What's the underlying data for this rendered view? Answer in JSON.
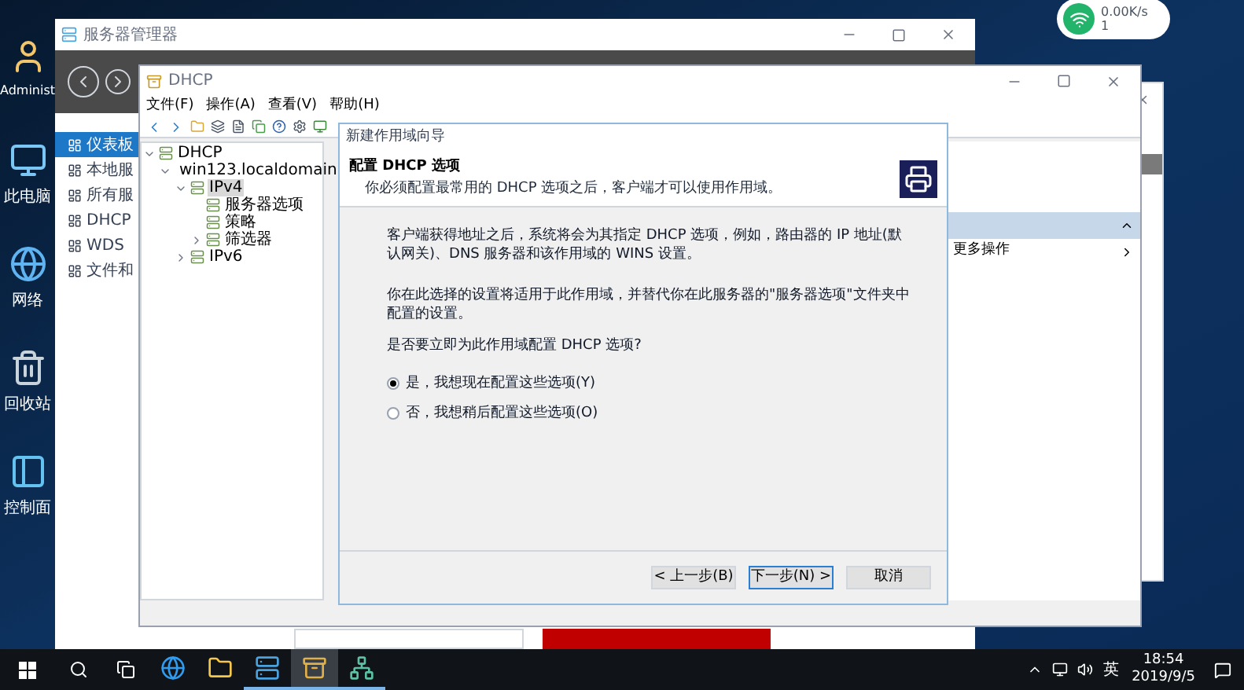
{
  "desktop_icons": [
    {
      "label": "Administ"
    },
    {
      "label": "此电脑"
    },
    {
      "label": "网络"
    },
    {
      "label": "回收站"
    },
    {
      "label": "控制面"
    }
  ],
  "net_widget": {
    "speed": "0.00K/s",
    "count": "1"
  },
  "server_manager": {
    "title": "服务器管理器",
    "nav": [
      {
        "label": "仪表板",
        "selected": true
      },
      {
        "label": "本地服",
        "selected": false
      },
      {
        "label": "所有服",
        "selected": false
      },
      {
        "label": "DHCP",
        "selected": false
      },
      {
        "label": "WDS",
        "selected": false
      },
      {
        "label": "文件和",
        "selected": false
      }
    ]
  },
  "dhcp_window": {
    "title": "DHCP",
    "menu": [
      "文件(F)",
      "操作(A)",
      "查看(V)",
      "帮助(H)"
    ],
    "tree": [
      {
        "label": "DHCP",
        "expanded": true,
        "selected": false,
        "children": [
          {
            "label": "win123.localdomain",
            "expanded": true,
            "selected": false,
            "children": [
              {
                "label": "IPv4",
                "expanded": true,
                "selected": true,
                "children": [
                  {
                    "label": "服务器选项",
                    "selected": false
                  },
                  {
                    "label": "策略",
                    "selected": false
                  },
                  {
                    "label": "筛选器",
                    "expanded": false,
                    "selected": false
                  }
                ]
              },
              {
                "label": "IPv6",
                "expanded": false,
                "selected": false
              }
            ]
          }
        ]
      }
    ],
    "actions": {
      "more": "更多操作"
    }
  },
  "wizard": {
    "title": "新建作用域向导",
    "heading": "配置 DHCP 选项",
    "subheading": "你必须配置最常用的 DHCP 选项之后，客户端才可以使用作用域。",
    "paragraphs": [
      "客户端获得地址之后，系统将会为其指定 DHCP 选项，例如，路由器的 IP 地址(默认网关)、DNS 服务器和该作用域的 WINS 设置。",
      "你在此选择的设置将适用于此作用域，并替代你在此服务器的\"服务器选项\"文件夹中配置的设置。"
    ],
    "question": "是否要立即为此作用域配置 DHCP 选项?",
    "options": [
      {
        "label": "是，我想现在配置这些选项(Y)",
        "selected": true
      },
      {
        "label": "否，我想稍后配置这些选项(O)",
        "selected": false
      }
    ],
    "buttons": [
      {
        "label": "< 上一步(B)",
        "default": false
      },
      {
        "label": "下一步(N) >",
        "default": true
      },
      {
        "label": "取消",
        "default": false
      }
    ]
  },
  "taskbar": {
    "apps": [
      {
        "selected": false,
        "running": false
      },
      {
        "selected": false,
        "running": false
      },
      {
        "selected": false,
        "running": true
      },
      {
        "selected": true,
        "running": true
      },
      {
        "selected": false,
        "running": true
      }
    ],
    "language": "英",
    "time": "18:54",
    "date": "2019/9/5"
  }
}
